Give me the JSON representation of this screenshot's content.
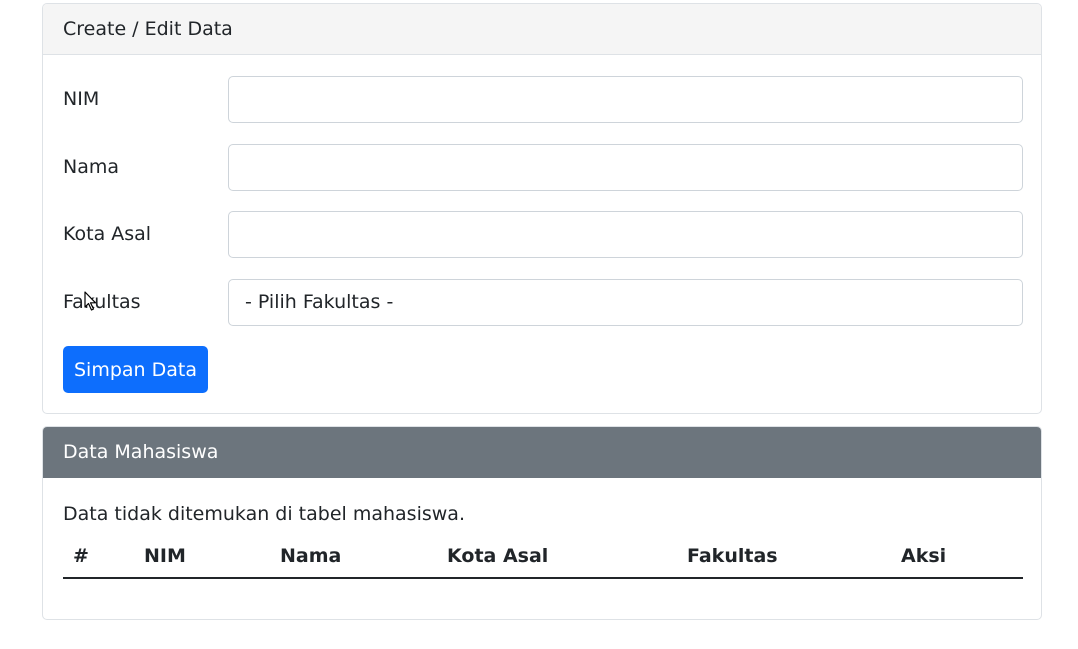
{
  "form_card": {
    "header": "Create / Edit Data",
    "fields": [
      {
        "label": "NIM",
        "value": "",
        "placeholder": ""
      },
      {
        "label": "Nama",
        "value": "",
        "placeholder": ""
      },
      {
        "label": "Kota Asal",
        "value": "",
        "placeholder": ""
      },
      {
        "label": "Fakultas",
        "selected": "- Pilih Fakultas -"
      }
    ],
    "submit_label": "Simpan Data"
  },
  "table_card": {
    "header": "Data Mahasiswa",
    "empty_message": "Data tidak ditemukan di tabel mahasiswa.",
    "columns": [
      "#",
      "NIM",
      "Nama",
      "Kota Asal",
      "Fakultas",
      "Aksi"
    ],
    "rows": []
  },
  "colors": {
    "primary": "#0d6efd",
    "secondary_header": "#6c757d",
    "light_header": "#f5f5f5"
  }
}
